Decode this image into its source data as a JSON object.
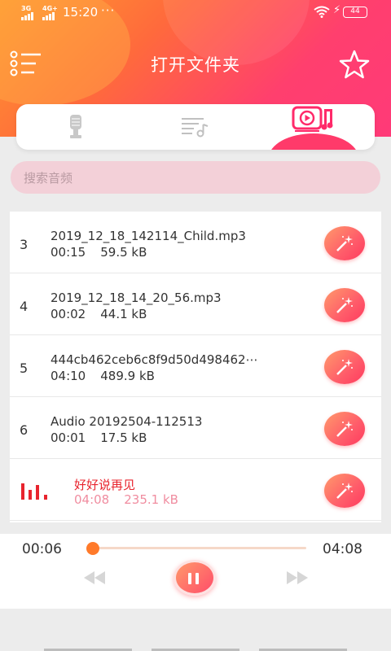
{
  "status": {
    "signal1": "3G",
    "signal2": "4G+",
    "time": "15:20",
    "dots": "···",
    "battery": "44"
  },
  "header": {
    "title": "打开文件夹"
  },
  "tabs": [
    {
      "icon": "microphone-icon"
    },
    {
      "icon": "playlist-icon"
    },
    {
      "icon": "video-music-icon",
      "active": true
    }
  ],
  "search": {
    "placeholder": "搜索音频"
  },
  "files": [
    {
      "index": "3",
      "name": "2019_12_18_142114_Child.mp3",
      "duration": "00:15",
      "size": "59.5 kB"
    },
    {
      "index": "4",
      "name": "2019_12_18_14_20_56.mp3",
      "duration": "00:02",
      "size": "44.1 kB"
    },
    {
      "index": "5",
      "name": "444cb462ceb6c8f9d50d498462⋯",
      "duration": "04:10",
      "size": "489.9 kB"
    },
    {
      "index": "6",
      "name": "Audio 20192504-112513",
      "duration": "00:01",
      "size": "17.5 kB"
    },
    {
      "index": "",
      "name": "好好说再见",
      "duration": "04:08",
      "size": "235.1 kB",
      "playing": true
    }
  ],
  "player": {
    "current_time": "00:06",
    "total_time": "04:08",
    "progress": 0.024
  },
  "colors": {
    "accent": "#ff3a6a",
    "playing_text": "#e8242e",
    "knob": "#ff7a2a"
  }
}
